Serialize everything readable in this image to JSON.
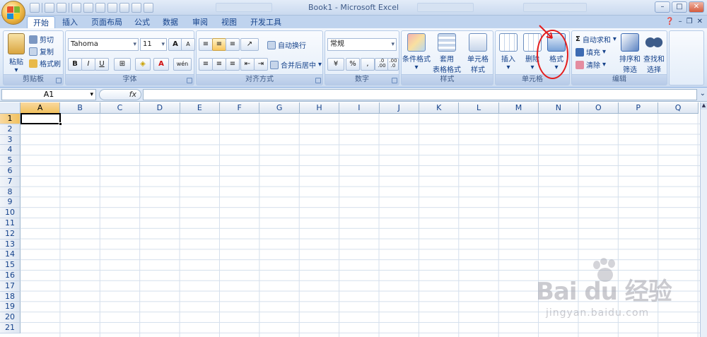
{
  "window": {
    "title": "Book1 - Microsoft Excel",
    "controls": [
      "–",
      "□",
      "✕"
    ]
  },
  "tabs": [
    {
      "label": "开始",
      "active": true
    },
    {
      "label": "插入"
    },
    {
      "label": "页面布局"
    },
    {
      "label": "公式"
    },
    {
      "label": "数据"
    },
    {
      "label": "审阅"
    },
    {
      "label": "视图"
    },
    {
      "label": "开发工具"
    }
  ],
  "ribbon": {
    "clipboard": {
      "title": "剪贴板",
      "paste": "粘贴",
      "cut": "剪切",
      "copy": "复制",
      "format_painter": "格式刷"
    },
    "font": {
      "title": "字体",
      "font_name": "Tahoma",
      "font_size": "11",
      "grow": "A",
      "shrink": "A",
      "bold": "B",
      "italic": "I",
      "underline": "U",
      "wen": "wén"
    },
    "alignment": {
      "title": "对齐方式",
      "wrap": "自动换行",
      "merge": "合并后居中"
    },
    "number": {
      "title": "数字",
      "format": "常规",
      "percent": "%",
      "comma": ",",
      "inc_decimal": ".0\n.00",
      "dec_decimal": ".00\n.0"
    },
    "styles": {
      "title": "样式",
      "cond_format": "条件格式",
      "table_format_1": "套用",
      "table_format_2": "表格格式",
      "cell_style_1": "单元格",
      "cell_style_2": "样式"
    },
    "cells": {
      "title": "单元格",
      "insert": "插入",
      "delete": "删除",
      "format": "格式"
    },
    "editing": {
      "title": "编辑",
      "autosum": "自动求和",
      "fill": "填充",
      "clear": "清除",
      "sort_1": "排序和",
      "sort_2": "筛选",
      "find_1": "查找和",
      "find_2": "选择"
    }
  },
  "formula_bar": {
    "name_box": "A1",
    "fx_label": "fx",
    "value": ""
  },
  "sheet": {
    "columns": [
      "A",
      "B",
      "C",
      "D",
      "E",
      "F",
      "G",
      "H",
      "I",
      "J",
      "K",
      "L",
      "M",
      "N",
      "O",
      "P",
      "Q"
    ],
    "rows": [
      "1",
      "2",
      "3",
      "4",
      "5",
      "6",
      "7",
      "8",
      "9",
      "10",
      "11",
      "12",
      "13",
      "14",
      "15",
      "16",
      "17",
      "18",
      "19",
      "20",
      "21"
    ],
    "active_cell": "A1"
  },
  "colors": {
    "accent": "#15428b",
    "annotation": "#e31d1d",
    "selected_header": "#f1c15f"
  },
  "watermark": {
    "brand": "Bai du 经验",
    "url": "jingyan.baidu.com"
  }
}
